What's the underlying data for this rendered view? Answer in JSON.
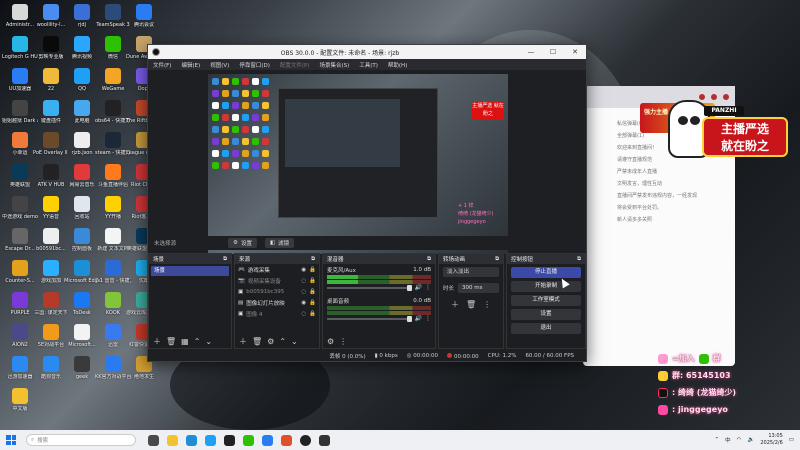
{
  "colors": {
    "accent": "#3b49a8",
    "obs_bg": "#1e1f22",
    "taskbar": "#eef0f4",
    "overlay_pink": "#ff4aa0"
  },
  "desktop_icons": [
    {
      "label": "Administr...",
      "color": "#d8d8d8"
    },
    {
      "label": "woolility-l...",
      "color": "#4a8df0"
    },
    {
      "label": "rjdj",
      "color": "#3a6fd8"
    },
    {
      "label": "TeamSpeak 3",
      "color": "#2d4b7a"
    },
    {
      "label": "腾讯会议",
      "color": "#2a7cf2"
    },
    {
      "label": "Logitech G HUB",
      "color": "#27b6e8"
    },
    {
      "label": "剪映专业版",
      "color": "#0a0a0a"
    },
    {
      "label": "腾讯视频",
      "color": "#2aa6ff"
    },
    {
      "label": "微信",
      "color": "#2dc100"
    },
    {
      "label": "Dune Awakeni...",
      "color": "#c9a56a"
    },
    {
      "label": "UU加速器",
      "color": "#2a7cf2"
    },
    {
      "label": "22",
      "color": "#f0b93a"
    },
    {
      "label": "QQ",
      "color": "#1fa0f7"
    },
    {
      "label": "WeGame",
      "color": "#f3a525"
    },
    {
      "label": "Oopz",
      "color": "#7b5cf0"
    },
    {
      "label": "姐姐越狱 Dark an...",
      "color": "#444"
    },
    {
      "label": "键盘插件",
      "color": "#3ab0f0"
    },
    {
      "label": "此电脑",
      "color": "#48a8ee"
    },
    {
      "label": "obs64 - 快捷方式",
      "color": "#222"
    },
    {
      "label": "The Riftbreak...",
      "color": "#c84a2a"
    },
    {
      "label": "小幸运",
      "color": "#f07a3a"
    },
    {
      "label": "PoE Overlay II Standal...",
      "color": "#6a4a2a"
    },
    {
      "label": "rjzb.json",
      "color": "#eeeeee"
    },
    {
      "label": "steam - 快捷方式",
      "color": "#1b2838"
    },
    {
      "label": "League of Legends...",
      "color": "#c89b3c"
    },
    {
      "label": "英雄联盟",
      "color": "#0a3a5a"
    },
    {
      "label": "ATK V HUB",
      "color": "#222"
    },
    {
      "label": "网易云音乐",
      "color": "#e23a3a"
    },
    {
      "label": "斗鱼直播伴侣",
      "color": "#ff7a1a"
    },
    {
      "label": "Riot Client",
      "color": "#d13639"
    },
    {
      "label": "中途游戏 demo",
      "color": "#444"
    },
    {
      "label": "YY语音",
      "color": "#ffd100"
    },
    {
      "label": "回收站",
      "color": "#dfe6ee"
    },
    {
      "label": "YY开播",
      "color": "#ffd100"
    },
    {
      "label": "Riot客户端",
      "color": "#d13639"
    },
    {
      "label": "Escape Dr...",
      "color": "#666"
    },
    {
      "label": "b00591bc...",
      "color": "#eeeeee"
    },
    {
      "label": "控制面板",
      "color": "#3a8ad8"
    },
    {
      "label": "新建 文本文档",
      "color": "#f4f4f4"
    },
    {
      "label": "英雄联盟(国服)",
      "color": "#0a3a5a"
    },
    {
      "label": "Counter-S...",
      "color": "#e4a11b"
    },
    {
      "label": "游戏加加",
      "color": "#2ab0ff"
    },
    {
      "label": "Microsoft Edge",
      "color": "#1d8fd6"
    },
    {
      "label": "7.1 雷音 - 快捷方式",
      "color": "#2a6bd8"
    },
    {
      "label": "优酷",
      "color": "#1fb0f0"
    },
    {
      "label": "PURPLE",
      "color": "#7a3ad8"
    },
    {
      "label": "三国: 谋定天下",
      "color": "#b53a2a"
    },
    {
      "label": "ToDesk",
      "color": "#1a78f2"
    },
    {
      "label": "KOOK",
      "color": "#83c53a"
    },
    {
      "label": "游戏云库加速 - 快捷...",
      "color": "#3ab0a0"
    },
    {
      "label": "AION2",
      "color": "#4a4a8a"
    },
    {
      "label": "5E对战平台",
      "color": "#f29a1a"
    },
    {
      "label": "Microsoft...",
      "color": "#f3f3f3"
    },
    {
      "label": "迅雷",
      "color": "#3a7af0"
    },
    {
      "label": "红警快速启动",
      "color": "#c83a2a"
    },
    {
      "label": "迅游加速器",
      "color": "#2a8af0"
    },
    {
      "label": "酷狗音乐",
      "color": "#2a8af0"
    },
    {
      "label": "geek",
      "color": "#3a3a3a"
    },
    {
      "label": "KK官方对战平台",
      "color": "#2a7af0"
    },
    {
      "label": "绝地求生",
      "color": "#d8a030"
    },
    {
      "label": "中文版",
      "color": "#f3c030"
    }
  ],
  "obs": {
    "title": "OBS 30.0.0 - 配置文件: 未命名 - 场景: rjzb",
    "menu": [
      "文件(F)",
      "编辑(E)",
      "视图(V)",
      "停靠窗口(D)",
      "配置文件(P)",
      "场景集合(S)",
      "工具(T)",
      "帮助(H)"
    ],
    "preview_badge": "主播严选 就在盼之",
    "preview_text": "+ 1 祥\n绮绮 (龙猫绮少)\njinggegeyo",
    "current_source_label": "未选择源",
    "properties_button": "设置",
    "filters_button": "滤镜",
    "docks": {
      "scenes": {
        "title": "场景",
        "items": [
          "场景"
        ]
      },
      "sources": {
        "title": "来源",
        "items": [
          {
            "name": "游戏采集",
            "icon": "gamepad-icon"
          },
          {
            "name": "视频采集设备",
            "icon": "camera-icon"
          },
          {
            "name": "b00591bc395",
            "icon": "image-icon"
          },
          {
            "name": "图像幻灯片放映",
            "icon": "slideshow-icon"
          },
          {
            "name": "图像 4",
            "icon": "image-icon"
          }
        ]
      },
      "mixer": {
        "title": "混音器",
        "channels": [
          {
            "name": "麦克风/Aux",
            "level": "1.0 dB"
          },
          {
            "name": "桌面音频",
            "level": "0.0 dB"
          }
        ]
      },
      "transitions": {
        "title": "转场动画",
        "type": "淡入淡出",
        "duration_label": "时长",
        "duration": "300 ms"
      },
      "controls": {
        "title": "控制按钮",
        "buttons": [
          "停止直播",
          "开始录制",
          "工作室模式",
          "设置",
          "退出"
        ]
      }
    },
    "status": {
      "dropped": "丢帧 0 (0.0%)",
      "bitrate": "0 kbps",
      "live_time": "00:00:00",
      "rec_time": "00:00:00",
      "cpu": "CPU: 1.2%",
      "fps": "60.00 / 60.00 FPS"
    }
  },
  "background_app": {
    "lines": [
      "私信弹幕(0)",
      "全部弹幕(1)",
      "欢迎来到直播间！",
      "请遵守直播规范",
      "严禁未成年人直播",
      "文明发言，理性互动",
      "直播间严禁发布违规内容，一经发现",
      "将会受到平台处罚。",
      "新人请多多关照"
    ],
    "banner": "强力主播 入驻了"
  },
  "panzhi": {
    "brand": "PANZHI",
    "badge_line1": "主播严选",
    "badge_line2": "就在盼之"
  },
  "overlay": {
    "line1": "=加入",
    "line1_tail": "群",
    "line2": "群: 65145103",
    "line3": ": 绮绮 (龙猫绮少)",
    "line4": ": jinggegeyo"
  },
  "taskbar": {
    "search_placeholder": "搜索",
    "lang": "中",
    "time": "13:05",
    "date": "2025/2/6"
  }
}
